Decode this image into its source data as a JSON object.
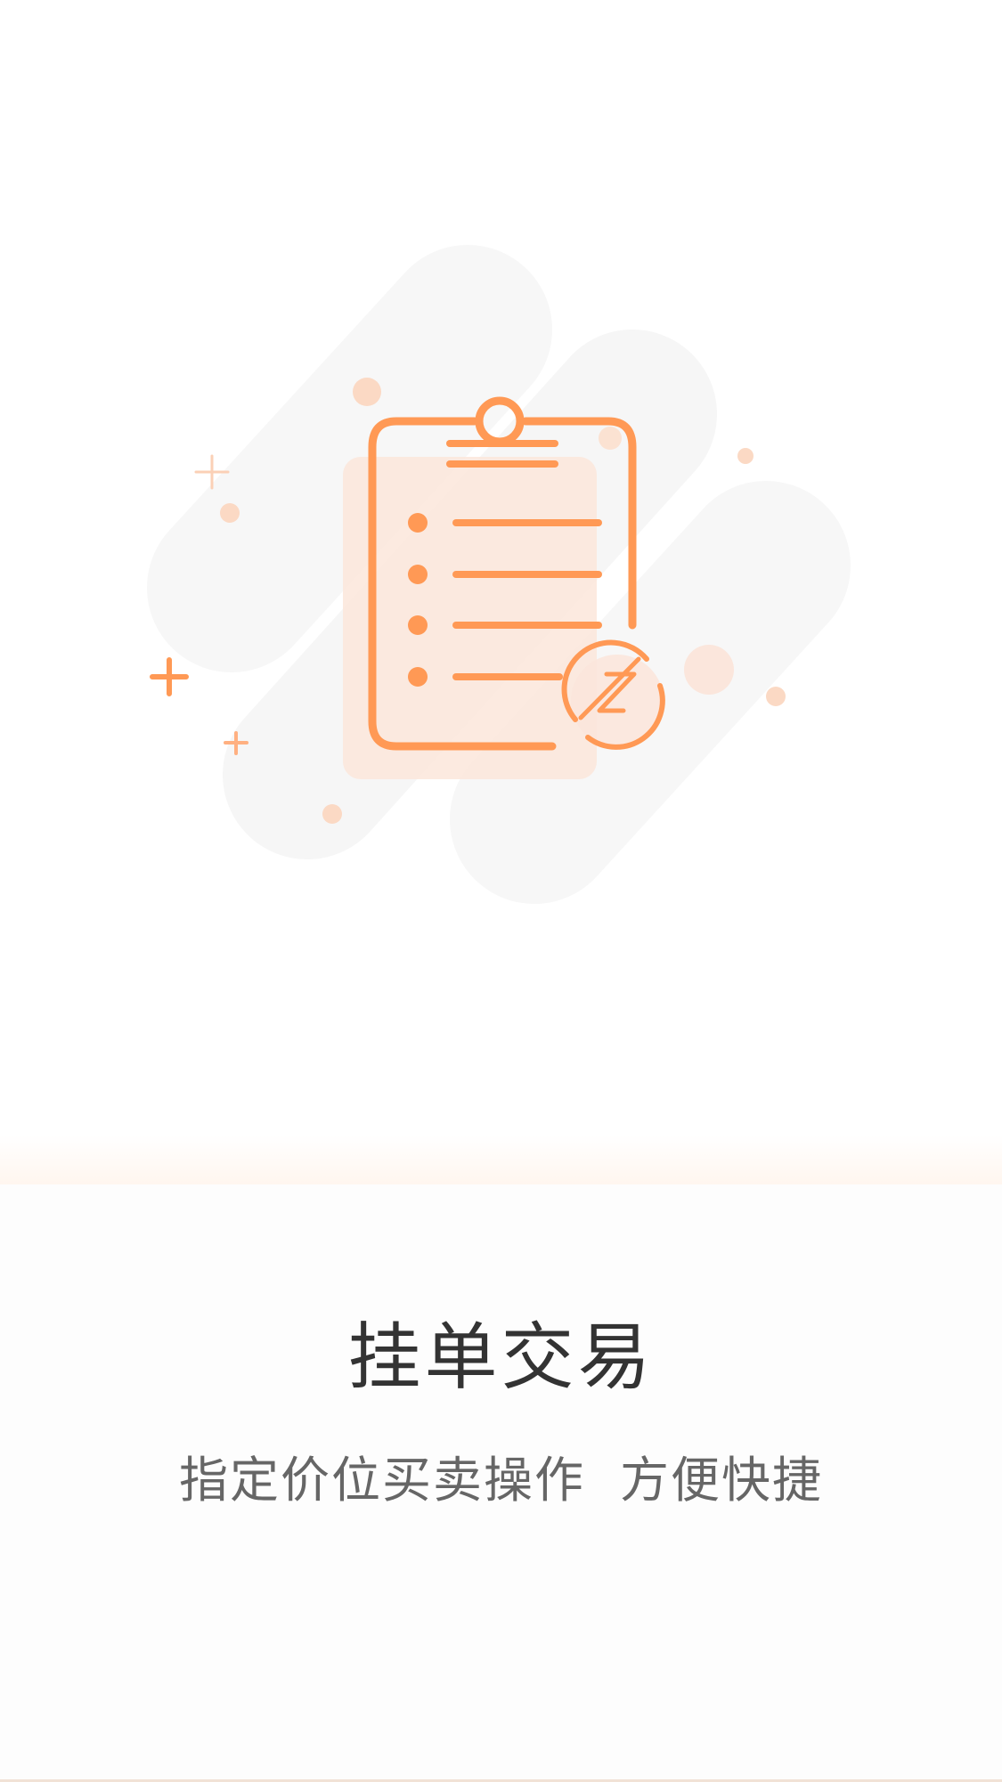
{
  "intro_page": {
    "title": "挂单交易",
    "subtitle": "指定价位买卖操作  方便快捷"
  },
  "illustration": {
    "icon": "clipboard-list-icon",
    "badge_icon": "z-coin-icon",
    "accent_color": "#ff9955",
    "soft_color": "#fbe6d9",
    "background_shape_color": "#f7f7f7"
  }
}
